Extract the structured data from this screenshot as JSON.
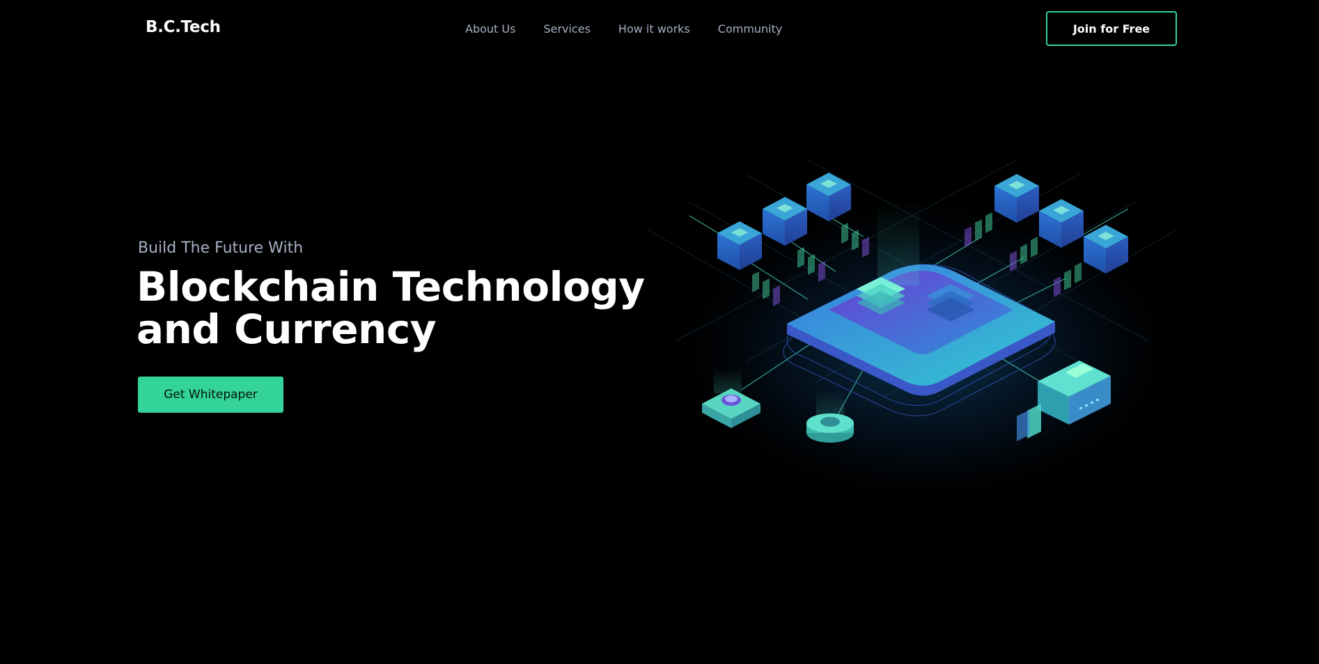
{
  "header": {
    "logo": "B.C.Tech",
    "nav": [
      {
        "label": "About Us"
      },
      {
        "label": "Services"
      },
      {
        "label": "How it works"
      },
      {
        "label": "Community"
      }
    ],
    "cta_label": "Join for Free"
  },
  "hero": {
    "eyebrow": "Build The Future With",
    "title_line1": "Blockchain Technology",
    "title_line2": "and Currency",
    "button_label": "Get Whitepaper"
  },
  "illustration": {
    "icon": "blockchain-isometric-illustration"
  },
  "colors": {
    "background": "#000000",
    "accent": "#34d399",
    "nav_text": "#a8b0c4",
    "cube_blue": "#2f6fd6",
    "cube_cyan": "#38c9d6",
    "chip_purple": "#6b3fd4"
  }
}
